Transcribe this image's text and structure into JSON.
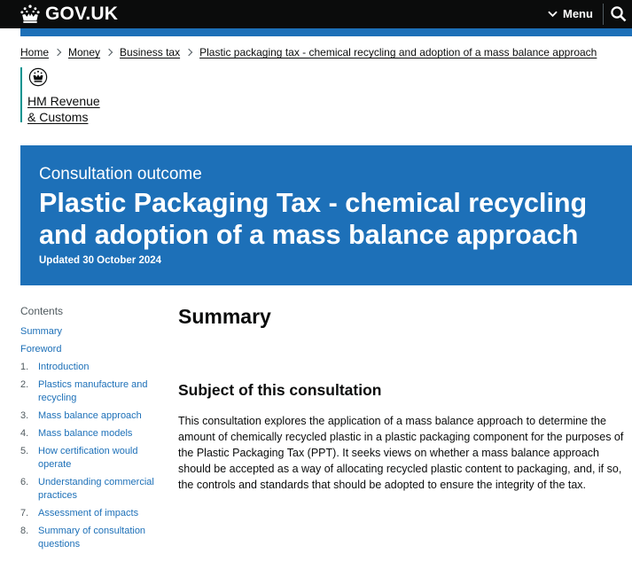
{
  "header": {
    "brand": "GOV.UK",
    "menu_label": "Menu",
    "search_icon": "search-icon",
    "crown_icon": "crown-icon"
  },
  "breadcrumbs": [
    {
      "label": "Home"
    },
    {
      "label": "Money"
    },
    {
      "label": "Business tax"
    },
    {
      "label": "Plastic packaging tax - chemical recycling and adoption of a mass balance approach"
    }
  ],
  "organisation": {
    "line1": "HM Revenue",
    "line2": "& Customs",
    "crest_icon": "royal-crest-icon",
    "accent": "#009390"
  },
  "banner": {
    "context": "Consultation outcome",
    "title": "Plastic Packaging Tax - chemical recycling and adoption of a mass balance approach",
    "updated": "Updated 30 October 2024",
    "background": "#1d70b8"
  },
  "contents": {
    "heading": "Contents",
    "items": [
      {
        "num": "",
        "label": "Summary"
      },
      {
        "num": "",
        "label": "Foreword"
      },
      {
        "num": "1.",
        "label": "Introduction"
      },
      {
        "num": "2.",
        "label": "Plastics manufacture and recycling"
      },
      {
        "num": "3.",
        "label": "Mass balance approach"
      },
      {
        "num": "4.",
        "label": "Mass balance models"
      },
      {
        "num": "5.",
        "label": "How certification would operate"
      },
      {
        "num": "6.",
        "label": "Understanding commercial practices"
      },
      {
        "num": "7.",
        "label": "Assessment of impacts"
      },
      {
        "num": "8.",
        "label": "Summary of consultation questions"
      }
    ]
  },
  "main": {
    "summary_heading": "Summary",
    "subject_heading": "Subject of this consultation",
    "subject_text": "This consultation explores the application of a mass balance approach to determine the amount of chemically recycled plastic in a plastic packaging component for the purposes of the Plastic Packaging Tax (PPT). It seeks views on whether a mass balance approach should be accepted as a way of allocating recycled plastic content to packaging, and, if so, the controls and standards that should be adopted to ensure the integrity of the tax."
  },
  "colors": {
    "header_bg": "#0b0c0c",
    "link": "#1d70b8",
    "text": "#0b0c0c"
  }
}
